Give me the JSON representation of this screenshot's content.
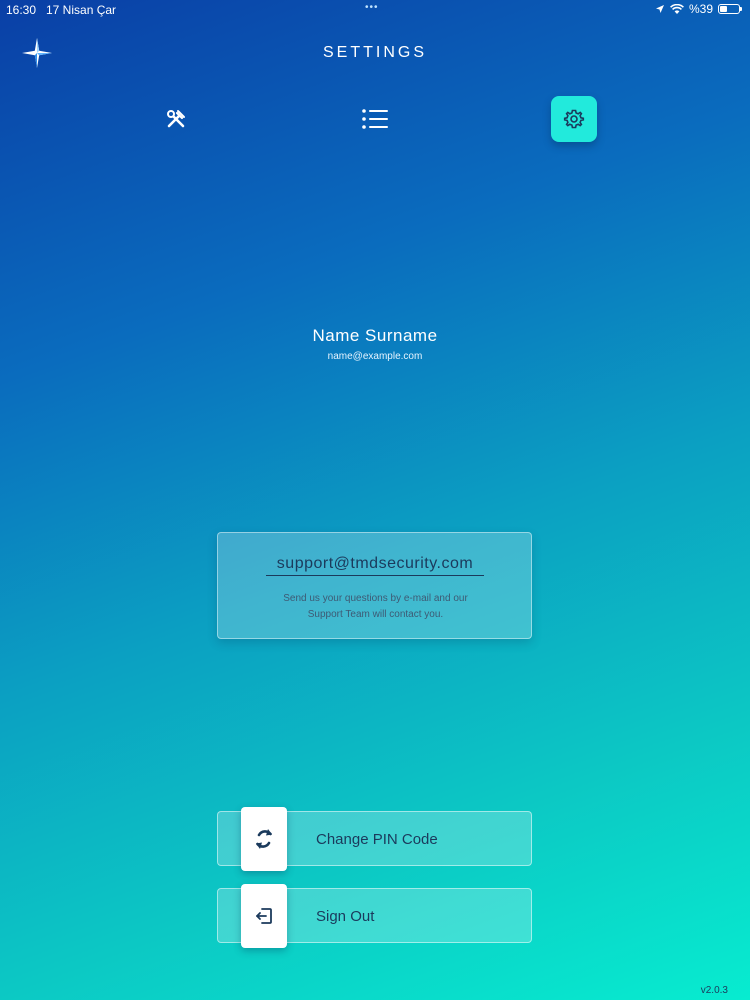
{
  "status_bar": {
    "time": "16:30",
    "date": "17 Nisan Çar",
    "dots": "•••",
    "battery_text": "%39",
    "battery_level": 0.39
  },
  "header": {
    "title": "SETTINGS",
    "logo_icon": "star-logo-icon"
  },
  "tabs": [
    {
      "id": "tools",
      "icon": "tools-icon",
      "active": false
    },
    {
      "id": "list",
      "icon": "list-icon",
      "active": false
    },
    {
      "id": "settings",
      "icon": "gear-icon",
      "active": true
    }
  ],
  "profile": {
    "name": "Name Surname",
    "email": "name@example.com"
  },
  "support": {
    "email": "support@tmdsecurity.com",
    "description_line1": "Send us your questions by e-mail and our",
    "description_line2": "Support Team will contact you."
  },
  "actions": {
    "change_pin": {
      "label": "Change PIN Code",
      "icon": "refresh-icon"
    },
    "sign_out": {
      "label": "Sign Out",
      "icon": "sign-out-icon"
    }
  },
  "footer": {
    "version": "v2.0.3"
  },
  "colors": {
    "accent": "#22eadc",
    "text_dark": "#1b3a5c",
    "gradient_top": "#0a3fa6",
    "gradient_bottom": "#07ecd0"
  }
}
